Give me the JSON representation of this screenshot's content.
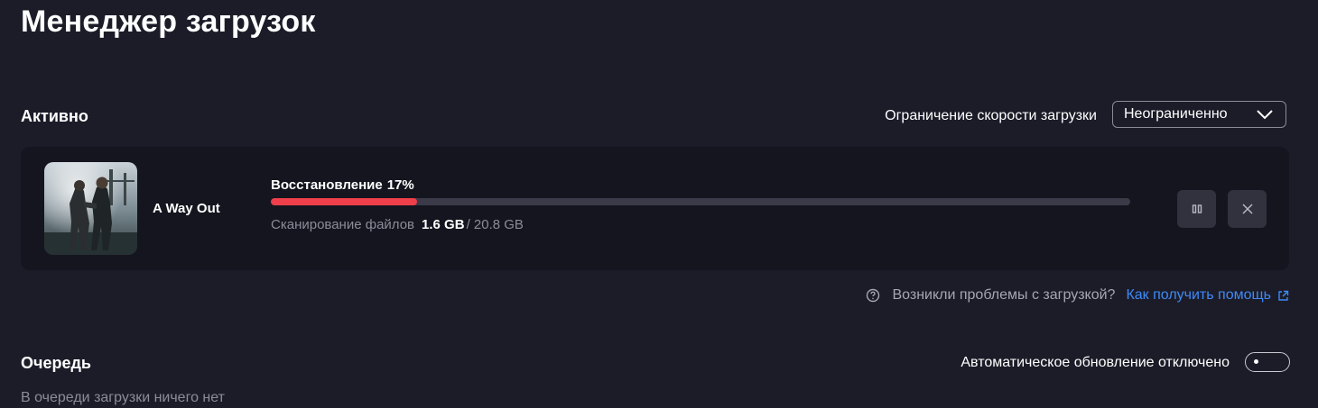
{
  "page": {
    "title": "Менеджер загрузок"
  },
  "active": {
    "title": "Активно",
    "speed_limit_label": "Ограничение скорости загрузки",
    "speed_limit_value": "Неограниченно"
  },
  "download": {
    "game_name": "A Way Out",
    "status_label": "Восстановление",
    "status_percent": "17%",
    "progress_fraction": 0.17,
    "scan_label": "Сканирование файлов",
    "size_done": "1.6 GB",
    "size_total": "/ 20.8 GB",
    "pause_icon": "pause-icon",
    "cancel_icon": "close-icon"
  },
  "help": {
    "icon": "question-circle-icon",
    "text": "Возникли проблемы с загрузкой?",
    "link_text": "Как получить помощь",
    "link_icon": "external-link-icon"
  },
  "queue": {
    "title": "Очередь",
    "auto_update_label": "Автоматическое обновление отключено",
    "auto_update_enabled": false,
    "empty_text": "В очереди загрузки ничего нет"
  },
  "colors": {
    "background": "#1c1c29",
    "card": "#15151f",
    "accent_progress": "#ef3f4a",
    "link": "#3d8af7"
  }
}
